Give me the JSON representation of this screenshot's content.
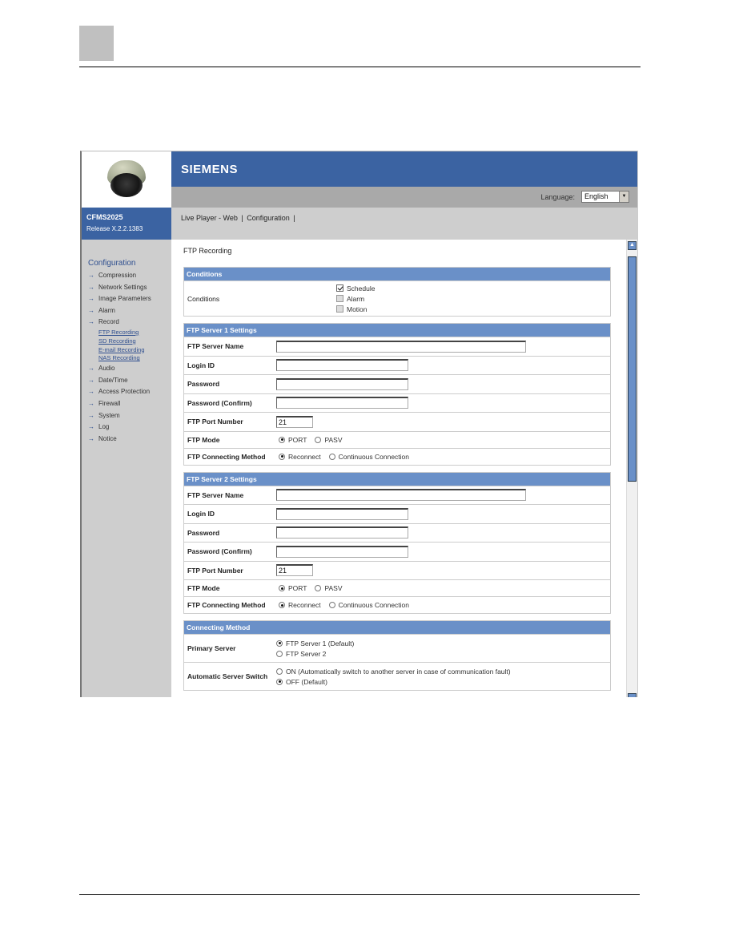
{
  "document": {
    "header_tab_color": "#c0c0c0"
  },
  "app": {
    "brand": "SIEMENS",
    "model": "CFMS2025",
    "release": "Release X.2.2.1383",
    "colors": {
      "primary": "#3b63a2",
      "section_header": "#6a90c8",
      "grey_bar": "#a9a9a9",
      "sidebar": "#cecece"
    }
  },
  "language": {
    "label": "Language:",
    "selected": "English"
  },
  "nav": {
    "items": [
      "Live Player - Web",
      "Configuration"
    ],
    "separator": "|"
  },
  "sidebar": {
    "title": "Configuration",
    "items": [
      {
        "label": "Compression"
      },
      {
        "label": "Network Settings"
      },
      {
        "label": "Image Parameters"
      },
      {
        "label": "Alarm"
      },
      {
        "label": "Record",
        "sub": [
          "FTP Recording",
          "SD Recording",
          "E-mail Recording",
          "NAS Recording"
        ]
      },
      {
        "label": "Audio"
      },
      {
        "label": "Date/Time"
      },
      {
        "label": "Access Protection"
      },
      {
        "label": "Firewall"
      },
      {
        "label": "System"
      },
      {
        "label": "Log"
      },
      {
        "label": "Notice"
      }
    ]
  },
  "page": {
    "title": "FTP Recording",
    "conditions": {
      "header": "Conditions",
      "label": "Conditions",
      "options": [
        {
          "label": "Schedule",
          "checked": true,
          "enabled": true
        },
        {
          "label": "Alarm",
          "checked": false,
          "enabled": false
        },
        {
          "label": "Motion",
          "checked": false,
          "enabled": false
        }
      ]
    },
    "servers": [
      {
        "header": "FTP Server 1 Settings",
        "server_name_label": "FTP Server Name",
        "server_name": "",
        "login_label": "Login ID",
        "login": "",
        "password_label": "Password",
        "password": "",
        "password_confirm_label": "Password (Confirm)",
        "password_confirm": "",
        "port_label": "FTP Port Number",
        "port": "21",
        "mode_label": "FTP Mode",
        "mode_options": [
          "PORT",
          "PASV"
        ],
        "mode_selected": "PORT",
        "method_label": "FTP Connecting Method",
        "method_options": [
          "Reconnect",
          "Continuous Connection"
        ],
        "method_selected": "Reconnect"
      },
      {
        "header": "FTP Server 2 Settings",
        "server_name_label": "FTP Server Name",
        "server_name": "",
        "login_label": "Login ID",
        "login": "",
        "password_label": "Password",
        "password": "",
        "password_confirm_label": "Password (Confirm)",
        "password_confirm": "",
        "port_label": "FTP Port Number",
        "port": "21",
        "mode_label": "FTP Mode",
        "mode_options": [
          "PORT",
          "PASV"
        ],
        "mode_selected": "PORT",
        "method_label": "FTP Connecting Method",
        "method_options": [
          "Reconnect",
          "Continuous Connection"
        ],
        "method_selected": "Reconnect"
      }
    ],
    "connecting_method": {
      "header": "Connecting Method",
      "primary_label": "Primary Server",
      "primary_options": [
        "FTP Server 1 (Default)",
        "FTP Server 2"
      ],
      "primary_selected": 0,
      "switch_label": "Automatic Server Switch",
      "switch_options": [
        "ON (Automatically switch to another server in case of communication fault)",
        "OFF (Default)"
      ],
      "switch_selected": 1
    }
  }
}
